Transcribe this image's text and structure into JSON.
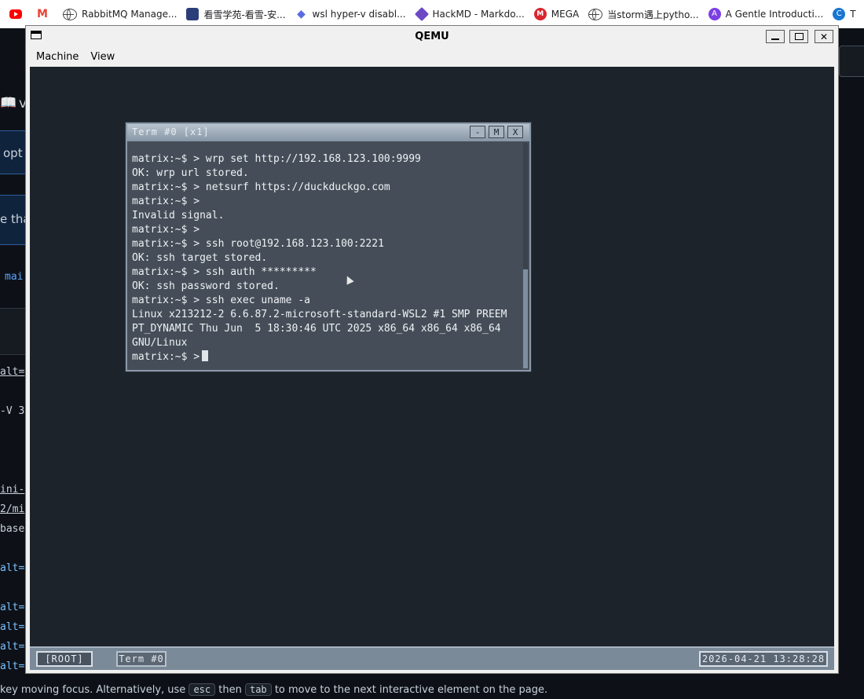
{
  "bookmarks": [
    {
      "label": "",
      "icon": "youtube-icon"
    },
    {
      "label": "",
      "icon": "gmail-icon"
    },
    {
      "label": "RabbitMQ Manage...",
      "icon": "globe-icon"
    },
    {
      "label": "看雪学苑-看雪-安...",
      "icon": "kanxue-icon"
    },
    {
      "label": "wsl hyper-v disabl...",
      "icon": "wsl-icon"
    },
    {
      "label": "HackMD - Markdo...",
      "icon": "hackmd-icon"
    },
    {
      "label": "MEGA",
      "icon": "mega-icon"
    },
    {
      "label": "当storm遇上pytho...",
      "icon": "globe-icon"
    },
    {
      "label": "A Gentle Introducti...",
      "icon": "gentle-icon"
    },
    {
      "label": "T",
      "icon": "tc-icon"
    }
  ],
  "background_page": {
    "fragments": [
      "v",
      "opt",
      "e that",
      "mai",
      "alt=",
      "-V 3",
      "ini-",
      "2/mi",
      "base",
      "alt=",
      "alt=",
      "alt=",
      "alt=",
      "alt="
    ],
    "bottom_hint": {
      "before": "key moving focus. Alternatively, use",
      "key1": "esc",
      "mid": "then",
      "key2": "tab",
      "after": "to move to the next interactive element on the page."
    }
  },
  "qemu": {
    "title": "QEMU",
    "menu": [
      "Machine",
      "View"
    ],
    "controls": {
      "minimize": "minimize",
      "maximize": "maximize",
      "close": "✕"
    }
  },
  "terminal": {
    "title": "Term #0 [x1]",
    "buttons": [
      "-",
      "M",
      "X"
    ],
    "lines": [
      "matrix:~$ > wrp set http://192.168.123.100:9999",
      "OK: wrp url stored.",
      "matrix:~$ > netsurf https://duckduckgo.com",
      "matrix:~$ >",
      "Invalid signal.",
      "matrix:~$ >",
      "matrix:~$ > ssh root@192.168.123.100:2221",
      "OK: ssh target stored.",
      "matrix:~$ > ssh auth *********",
      "OK: ssh password stored.",
      "matrix:~$ > ssh exec uname -a",
      "Linux x213212-2 6.6.87.2-microsoft-standard-WSL2 #1 SMP PREEM",
      "PT_DYNAMIC Thu Jun  5 18:30:46 UTC 2025 x86_64 x86_64 x86_64",
      "GNU/Linux"
    ],
    "prompt": "matrix:~$ >"
  },
  "taskbar": {
    "root": "[ROOT]",
    "term": "Term #0",
    "clock": "2026-04-21 13:28:28"
  }
}
